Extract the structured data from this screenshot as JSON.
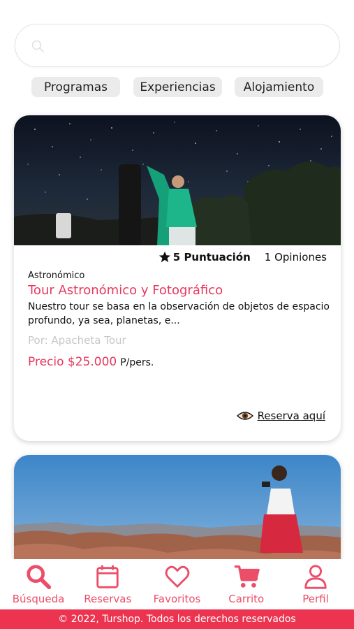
{
  "search": {
    "placeholder": "",
    "value": ""
  },
  "filters": [
    {
      "label": "Programas"
    },
    {
      "label": "Experiencias"
    },
    {
      "label": "Alojamiento"
    }
  ],
  "cards": [
    {
      "image": "night-sky-stargazing-photo",
      "rating": {
        "score_label": "5 Puntuación",
        "reviews_label": "1 Opiniones"
      },
      "category": "Astronómico",
      "title": "Tour Astronómico y Fotográfico",
      "description": "Nuestro tour se basa en la observación de objetos de espacio profundo, ya sea, planetas, e...",
      "provider": "Por: Apacheta Tour",
      "price": "Precio $25.000",
      "price_unit": "P/pers.",
      "reserve_label": "Reserva aquí"
    },
    {
      "image": "desert-valley-photographer-photo"
    }
  ],
  "bottom_nav": [
    {
      "label": "Búsqueda",
      "icon": "search-icon"
    },
    {
      "label": "Reservas",
      "icon": "calendar-icon"
    },
    {
      "label": "Favoritos",
      "icon": "heart-icon"
    },
    {
      "label": "Carrito",
      "icon": "cart-icon"
    },
    {
      "label": "Perfil",
      "icon": "user-icon"
    }
  ],
  "footer": {
    "text": "© 2022, Turshop. Todos los derechos reservados"
  },
  "colors": {
    "accent": "#e8385c",
    "nav": "#ec4d68",
    "footer_bg": "#ec3450"
  }
}
